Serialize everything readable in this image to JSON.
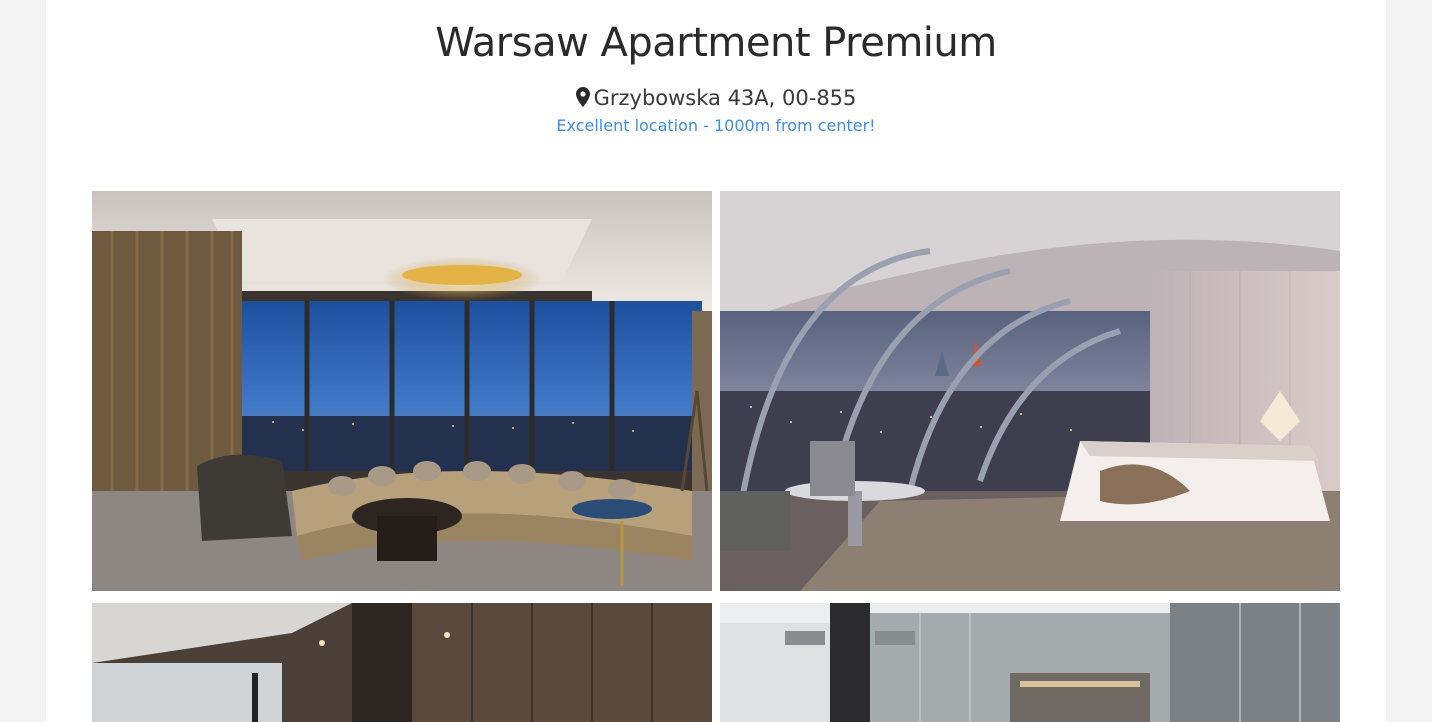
{
  "listing": {
    "title": "Warsaw Apartment Premium",
    "address": "Grzybowska 43A, 00-855",
    "location_note": "Excellent location - 1000m from center!",
    "address_icon": "map-marker-icon"
  },
  "gallery": {
    "photos": [
      {
        "name": "living-room-photo",
        "alt": "Living room with curved sofa and city view"
      },
      {
        "name": "bedroom-photo",
        "alt": "Bedroom with curved glass facade and skyline view"
      },
      {
        "name": "kitchen-photo",
        "alt": "Dark wood kitchen interior"
      },
      {
        "name": "bathroom-photo",
        "alt": "Marble bathroom interior"
      }
    ]
  },
  "colors": {
    "accent": "#3f8ee6",
    "title": "#2a2a2a",
    "background": "#f3f3f3"
  }
}
